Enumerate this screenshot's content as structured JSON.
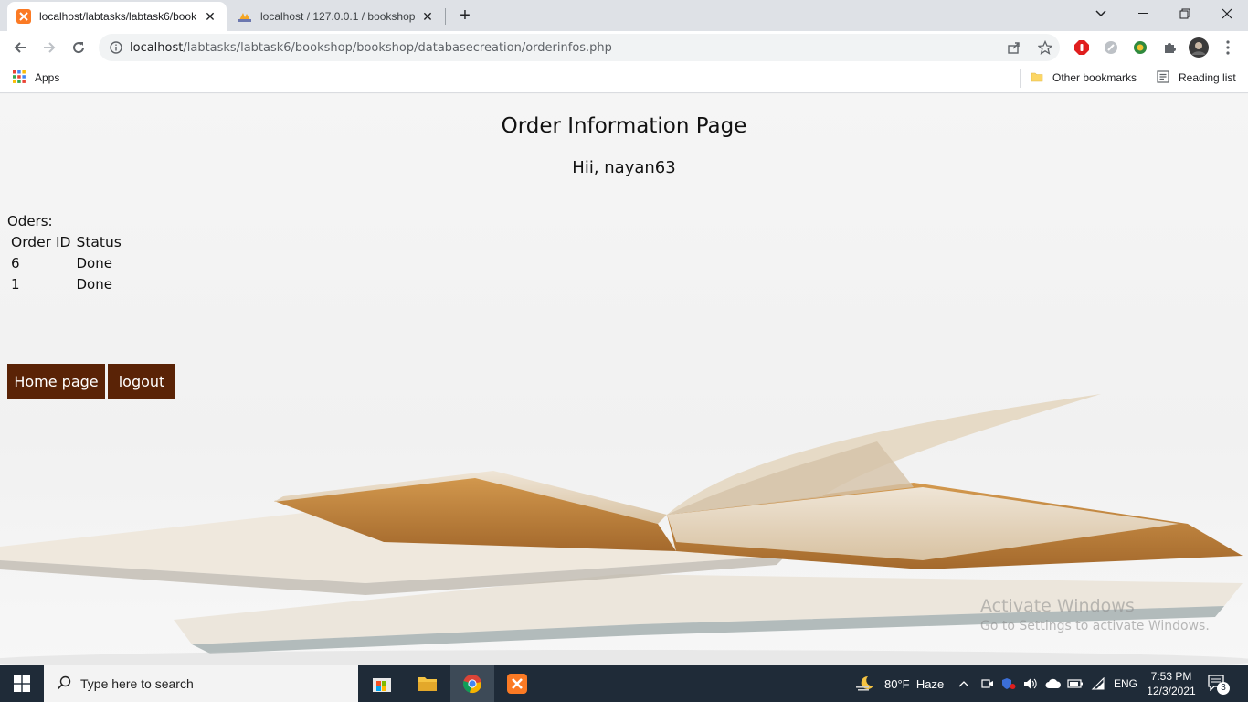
{
  "browser": {
    "tabs": [
      {
        "title": "localhost/labtasks/labtask6/book",
        "favicon": "xampp-icon",
        "active": true
      },
      {
        "title": "localhost / 127.0.0.1 / bookshop",
        "favicon": "phpmyadmin-icon",
        "active": false
      }
    ],
    "url_host": "localhost",
    "url_path": "/labtasks/labtask6/bookshop/bookshop/databasecreation/orderinfos.php",
    "bookmarks": {
      "apps": "Apps",
      "other": "Other bookmarks",
      "reading_list": "Reading list"
    }
  },
  "page": {
    "title": "Order Information Page",
    "greeting": "Hii, nayan63",
    "orders_label": "Oders:",
    "table": {
      "headers": [
        "Order ID",
        "Status"
      ],
      "rows": [
        {
          "id": "6",
          "status": "Done"
        },
        {
          "id": "1",
          "status": "Done"
        }
      ]
    },
    "buttons": {
      "home": "Home page",
      "logout": "logout"
    },
    "watermark": {
      "line1": "Activate Windows",
      "line2": "Go to Settings to activate Windows."
    },
    "colors": {
      "button_bg": "#5a2306"
    }
  },
  "taskbar": {
    "search_placeholder": "Type here to search",
    "weather": "80°F  Haze",
    "language": "ENG",
    "time": "7:53 PM",
    "date": "12/3/2021",
    "notifications": "3"
  }
}
